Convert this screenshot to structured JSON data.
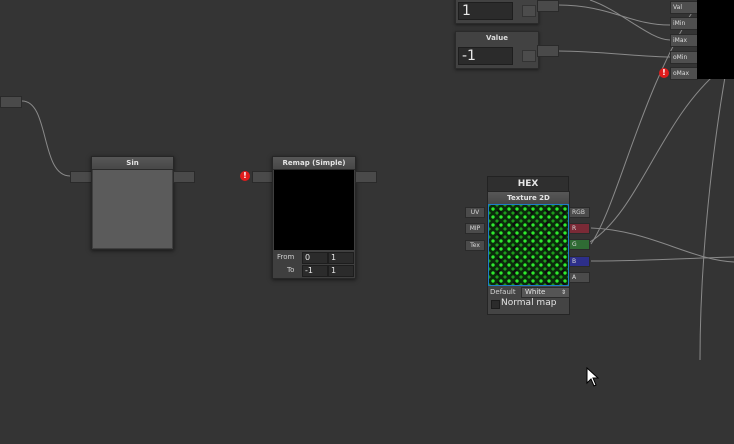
{
  "nodes": {
    "value_top": {
      "value": "1"
    },
    "value_node": {
      "title": "Value",
      "value": "-1"
    },
    "sin": {
      "title": "Sin"
    },
    "remap": {
      "title": "Remap (Simple)",
      "from_label": "From",
      "from_a": "0",
      "from_b": "1",
      "to_label": "To",
      "to_a": "-1",
      "to_b": "1"
    },
    "hex": {
      "header": "HEX",
      "title": "Texture 2D",
      "inputs": [
        "UV",
        "MIP",
        "Tex"
      ],
      "outputs": [
        "RGB",
        "R",
        "G",
        "B",
        "A"
      ],
      "default_label": "Default",
      "default_value": "White",
      "normal_map_label": "Normal map"
    },
    "remap_inputs": {
      "labels": [
        "Val",
        "iMin",
        "iMax",
        "oMin",
        "oMax"
      ]
    }
  },
  "colors": {
    "background": "#343434",
    "wire": "#8a8a8a",
    "error": "#e01c1c",
    "port_r": "#7a2a36",
    "port_g": "#2f6b34",
    "port_b": "#2d2f8a"
  },
  "icons": {
    "error": "error-icon",
    "cursor": "mouse-cursor-icon"
  }
}
